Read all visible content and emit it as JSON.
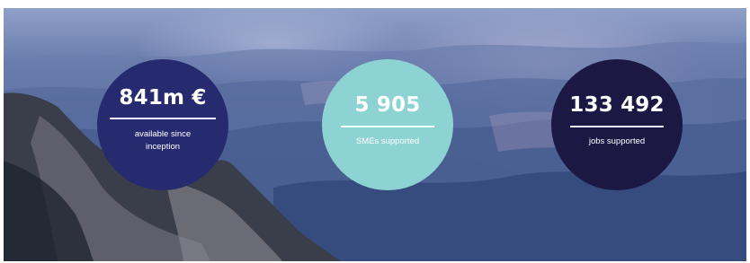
{
  "stats": [
    {
      "value": "841m €",
      "label": "available since inception",
      "color": "#262b6f"
    },
    {
      "value": "5 905",
      "label": "SMEs supported",
      "color": "#8ed3d3"
    },
    {
      "value": "133 492",
      "label": "jobs supported",
      "color": "#1c1844"
    }
  ]
}
